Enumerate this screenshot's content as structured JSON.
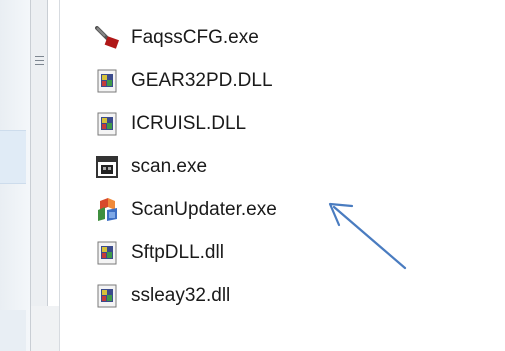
{
  "files": [
    {
      "name": "FaqssCFG.exe",
      "icon": "config-tool-icon"
    },
    {
      "name": "GEAR32PD.DLL",
      "icon": "dll-file-icon"
    },
    {
      "name": "ICRUISL.DLL",
      "icon": "dll-file-icon"
    },
    {
      "name": "scan.exe",
      "icon": "application-icon"
    },
    {
      "name": "ScanUpdater.exe",
      "icon": "updater-app-icon"
    },
    {
      "name": "SftpDLL.dll",
      "icon": "dll-file-icon"
    },
    {
      "name": "ssleay32.dll",
      "icon": "dll-file-icon"
    }
  ],
  "annotation": {
    "target": "ScanUpdater.exe",
    "color": "#4a7cc0"
  }
}
